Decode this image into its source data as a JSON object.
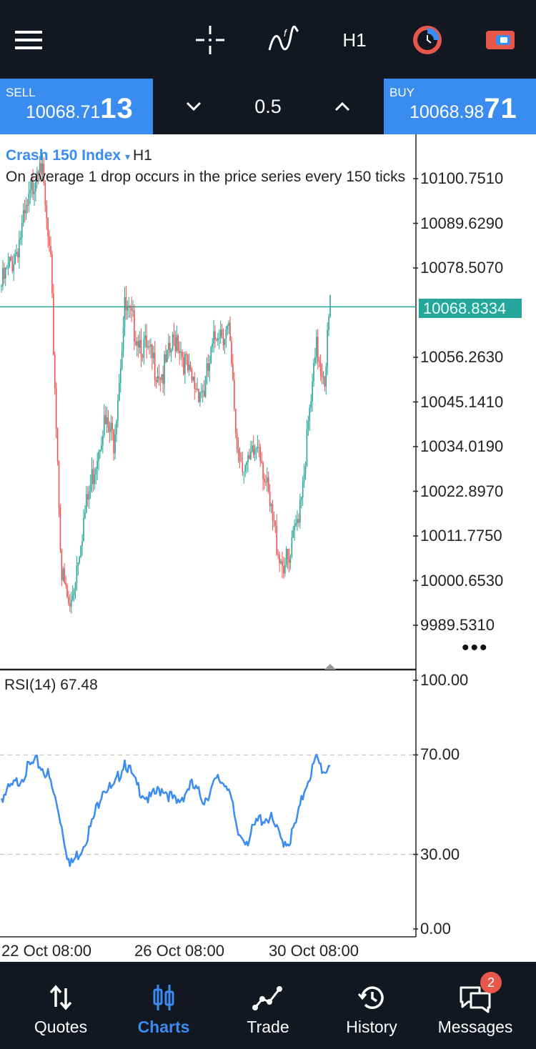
{
  "toolbar": {
    "menu_icon": "hamburger-menu-icon",
    "crosshair_icon": "crosshair-icon",
    "indicators_icon": "indicators-icon",
    "timeframe": "H1",
    "one_click_icon": "one-click-trading-icon",
    "new_order_icon": "new-order-icon"
  },
  "trade_panel": {
    "sell_label": "SELL",
    "sell_price_main": "10068.71",
    "sell_price_pips": "13",
    "buy_label": "BUY",
    "buy_price_main": "10068.98",
    "buy_price_pips": "71",
    "volume": "0.5"
  },
  "symbol": {
    "name": "Crash 150 Index",
    "timeframe": "H1",
    "description": "On average 1 drop occurs in the price series every 150 ticks"
  },
  "colors": {
    "accent": "#3a8cf0",
    "bull": "#26a69a",
    "bear": "#ef5350",
    "rsi_line": "#3a8cf0",
    "current_price_bg": "#26a69a",
    "dark_bg": "#131722",
    "badge": "#e8584a"
  },
  "chart_data": [
    {
      "type": "candlestick",
      "title": "Crash 150 Index",
      "timeframe": "H1",
      "y_ticks": [
        "10100.7510",
        "10089.6290",
        "10078.5070",
        "10056.2630",
        "10045.1410",
        "10034.0190",
        "10022.8970",
        "10011.7750",
        "10000.6530",
        "9989.5310"
      ],
      "ylim": [
        9979,
        10113
      ],
      "current_price": "10068.8334",
      "x_ticks": [
        "22 Oct 08:00",
        "26 Oct 08:00",
        "30 Oct 08:00"
      ],
      "close_trend": [
        [
          0,
          10074
        ],
        [
          10,
          10082
        ],
        [
          20,
          10094
        ],
        [
          28,
          10108
        ],
        [
          36,
          10078
        ],
        [
          44,
          10002
        ],
        [
          50,
          9993
        ],
        [
          58,
          10012
        ],
        [
          66,
          10026
        ],
        [
          74,
          10040
        ],
        [
          82,
          10036
        ],
        [
          90,
          10068
        ],
        [
          98,
          10063
        ],
        [
          108,
          10056
        ],
        [
          118,
          10052
        ],
        [
          128,
          10062
        ],
        [
          138,
          10050
        ],
        [
          148,
          10048
        ],
        [
          158,
          10064
        ],
        [
          166,
          10062
        ],
        [
          172,
          10034
        ],
        [
          180,
          10028
        ],
        [
          188,
          10036
        ],
        [
          196,
          10018
        ],
        [
          204,
          10006
        ],
        [
          210,
          10004
        ],
        [
          216,
          10016
        ],
        [
          222,
          10032
        ],
        [
          230,
          10058
        ],
        [
          236,
          10052
        ],
        [
          240,
          10069
        ]
      ],
      "grid": false
    },
    {
      "type": "line",
      "indicator": "RSI(14)",
      "current_value": "67.48",
      "y_ticks": [
        "100.00",
        "70.00",
        "30.00",
        "0.00"
      ],
      "ylim": [
        0,
        100
      ],
      "levels": [
        70,
        30
      ],
      "values_trend": [
        [
          0,
          53
        ],
        [
          10,
          58
        ],
        [
          20,
          65
        ],
        [
          26,
          67
        ],
        [
          34,
          62
        ],
        [
          42,
          47
        ],
        [
          50,
          25
        ],
        [
          58,
          32
        ],
        [
          66,
          42
        ],
        [
          74,
          57
        ],
        [
          82,
          56
        ],
        [
          90,
          68
        ],
        [
          98,
          58
        ],
        [
          108,
          52
        ],
        [
          118,
          57
        ],
        [
          128,
          50
        ],
        [
          138,
          58
        ],
        [
          148,
          52
        ],
        [
          158,
          60
        ],
        [
          166,
          58
        ],
        [
          172,
          38
        ],
        [
          180,
          36
        ],
        [
          188,
          44
        ],
        [
          196,
          45
        ],
        [
          204,
          36
        ],
        [
          210,
          35
        ],
        [
          216,
          44
        ],
        [
          222,
          58
        ],
        [
          230,
          68
        ],
        [
          236,
          63
        ],
        [
          240,
          67.48
        ]
      ]
    }
  ],
  "bottom_nav": {
    "items": [
      {
        "label": "Quotes",
        "icon": "quotes-arrows-icon"
      },
      {
        "label": "Charts",
        "icon": "charts-candles-icon"
      },
      {
        "label": "Trade",
        "icon": "trade-line-icon"
      },
      {
        "label": "History",
        "icon": "history-clock-icon"
      },
      {
        "label": "Messages",
        "icon": "messages-bubble-icon",
        "badge": "2"
      }
    ],
    "active": "Charts"
  }
}
